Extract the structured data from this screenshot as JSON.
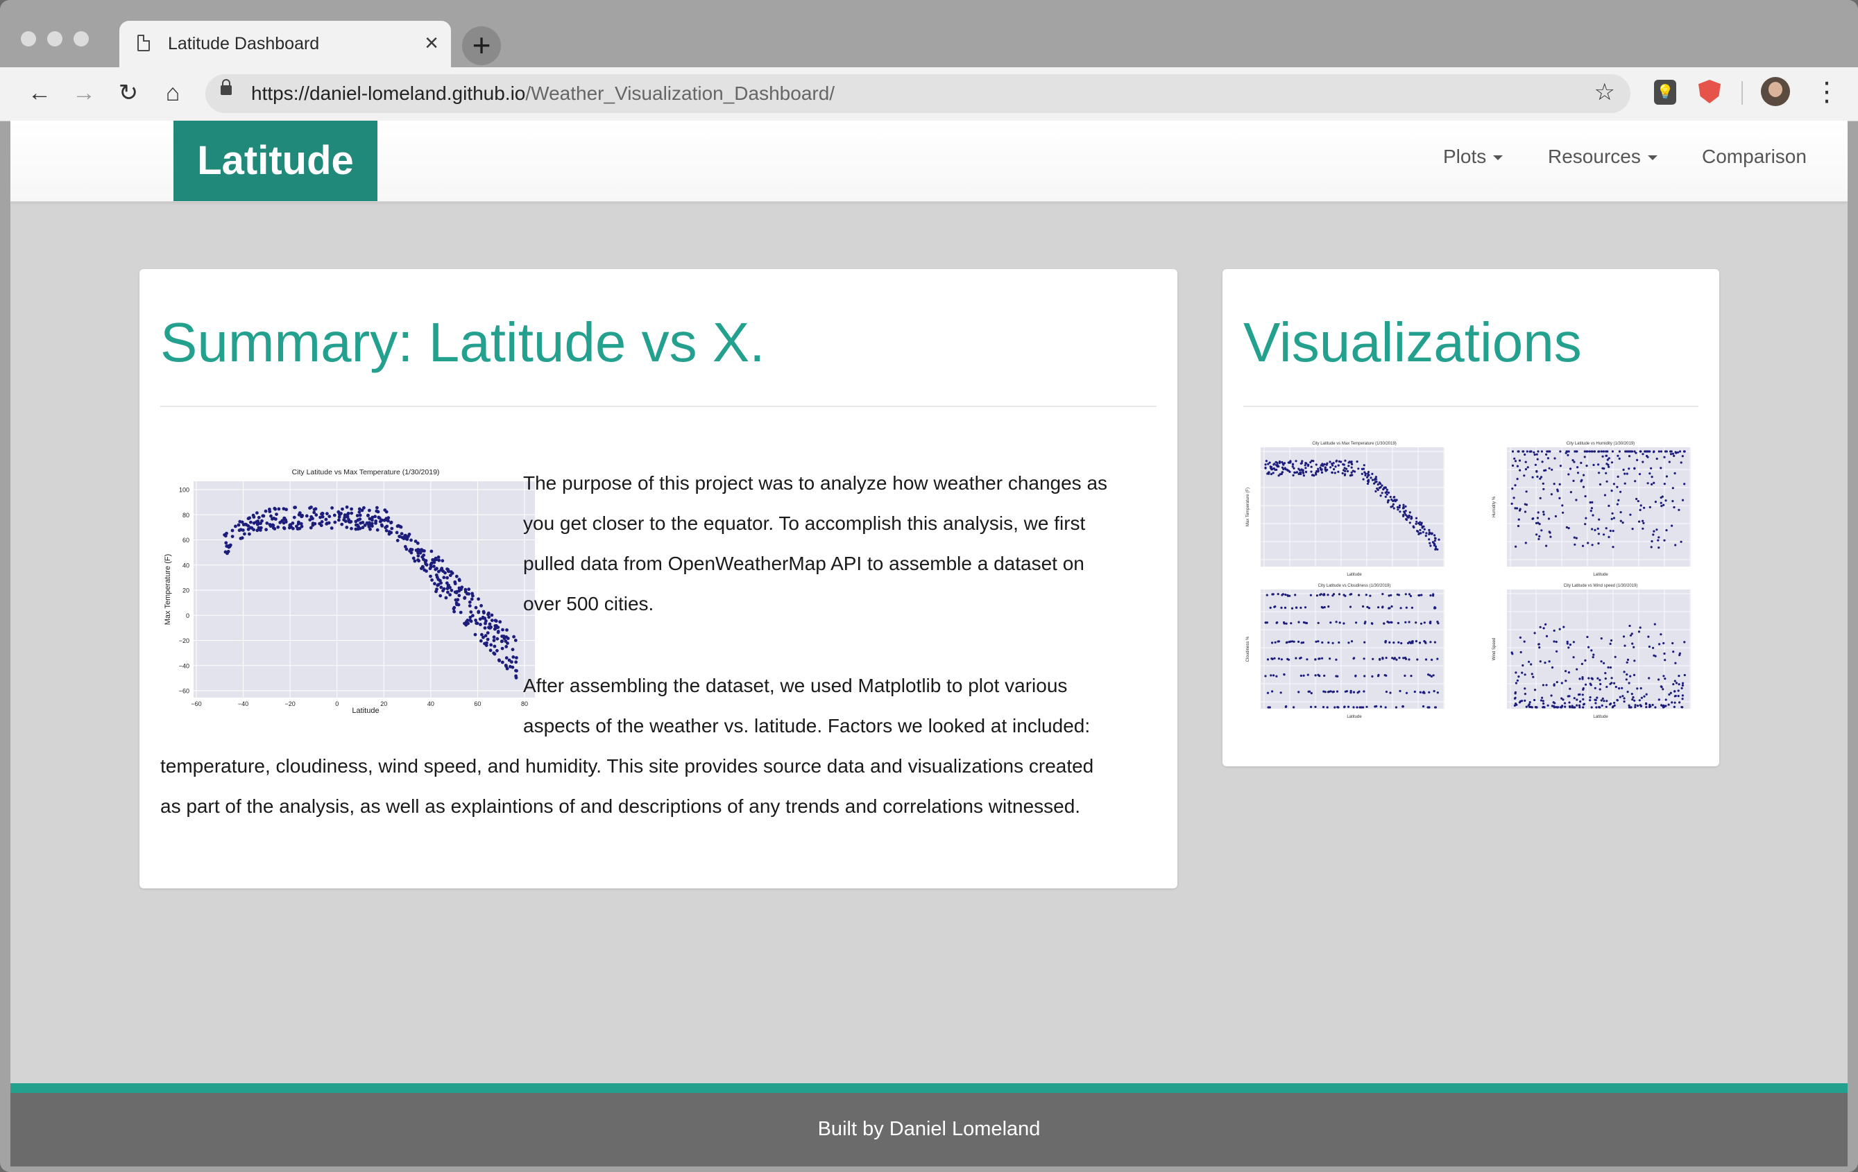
{
  "browser": {
    "tab_title": "Latitude Dashboard",
    "tab_close": "×",
    "new_tab": "+",
    "url_host": "https://daniel-lomeland.github.io",
    "url_path": "/Weather_Visualization_Dashboard/",
    "back": "←",
    "forward": "→",
    "reload": "↻",
    "home": "⌂",
    "bookmark": "☆",
    "menu": "⋮"
  },
  "navbar": {
    "brand": "Latitude",
    "items": [
      {
        "label": "Plots",
        "dropdown": true
      },
      {
        "label": "Resources",
        "dropdown": true
      },
      {
        "label": "Comparison",
        "dropdown": false
      }
    ]
  },
  "summary": {
    "heading": "Summary: Latitude vs X.",
    "lines": [
      "The purpose of this project was to analyze how weather changes as",
      "you get closer to the equator. To accomplish this analysis, we first",
      "pulled data from OpenWeatherMap API to assemble a dataset on",
      "over 500 cities.",
      "After assembling the dataset, we used Matplotlib to plot various",
      "aspects of the weather vs. latitude. Factors we looked at included:",
      "temperature, cloudiness, wind speed, and humidity. This site provides source data and visualizations created",
      "as part of the analysis, as well as explaintions of and descriptions of any trends and correlations witnessed."
    ]
  },
  "visualizations": {
    "heading": "Visualizations"
  },
  "charts": {
    "main": {
      "title": "City Latitude vs Max Temperature (1/30/2019)",
      "xlabel": "Latitude",
      "ylabel": "Max Temperature (F)",
      "xticks": [
        "−60",
        "−40",
        "−20",
        "0",
        "20",
        "40",
        "60",
        "80"
      ],
      "yticks": [
        "100",
        "80",
        "60",
        "40",
        "20",
        "0",
        "−20",
        "−40",
        "−60"
      ]
    },
    "thumbs": [
      {
        "title": "City Latitude vs Max Temperature (1/30/2019)",
        "xlabel": "Latitude",
        "ylabel": "Max Temperature (F)"
      },
      {
        "title": "City Latitude vs Humidity (1/30/2019)",
        "xlabel": "Latitude",
        "ylabel": "Humidity %"
      },
      {
        "title": "City Latitude vs Cloudiness (1/30/2019)",
        "xlabel": "Latitude",
        "ylabel": "Cloudiness %"
      },
      {
        "title": "City Latitude vs Wind speed (1/30/2019)",
        "xlabel": "Latitude",
        "ylabel": "Wind Speed"
      }
    ]
  },
  "footer": {
    "text": "Built by Daniel Lomeland"
  },
  "colors": {
    "accent": "#23a08e",
    "brand_bg": "#20897a",
    "point": "#1c1c7a",
    "plot_bg": "#e3e3ee",
    "page_bg": "#d4d4d4",
    "footer_bg": "#6b6b6b"
  }
}
